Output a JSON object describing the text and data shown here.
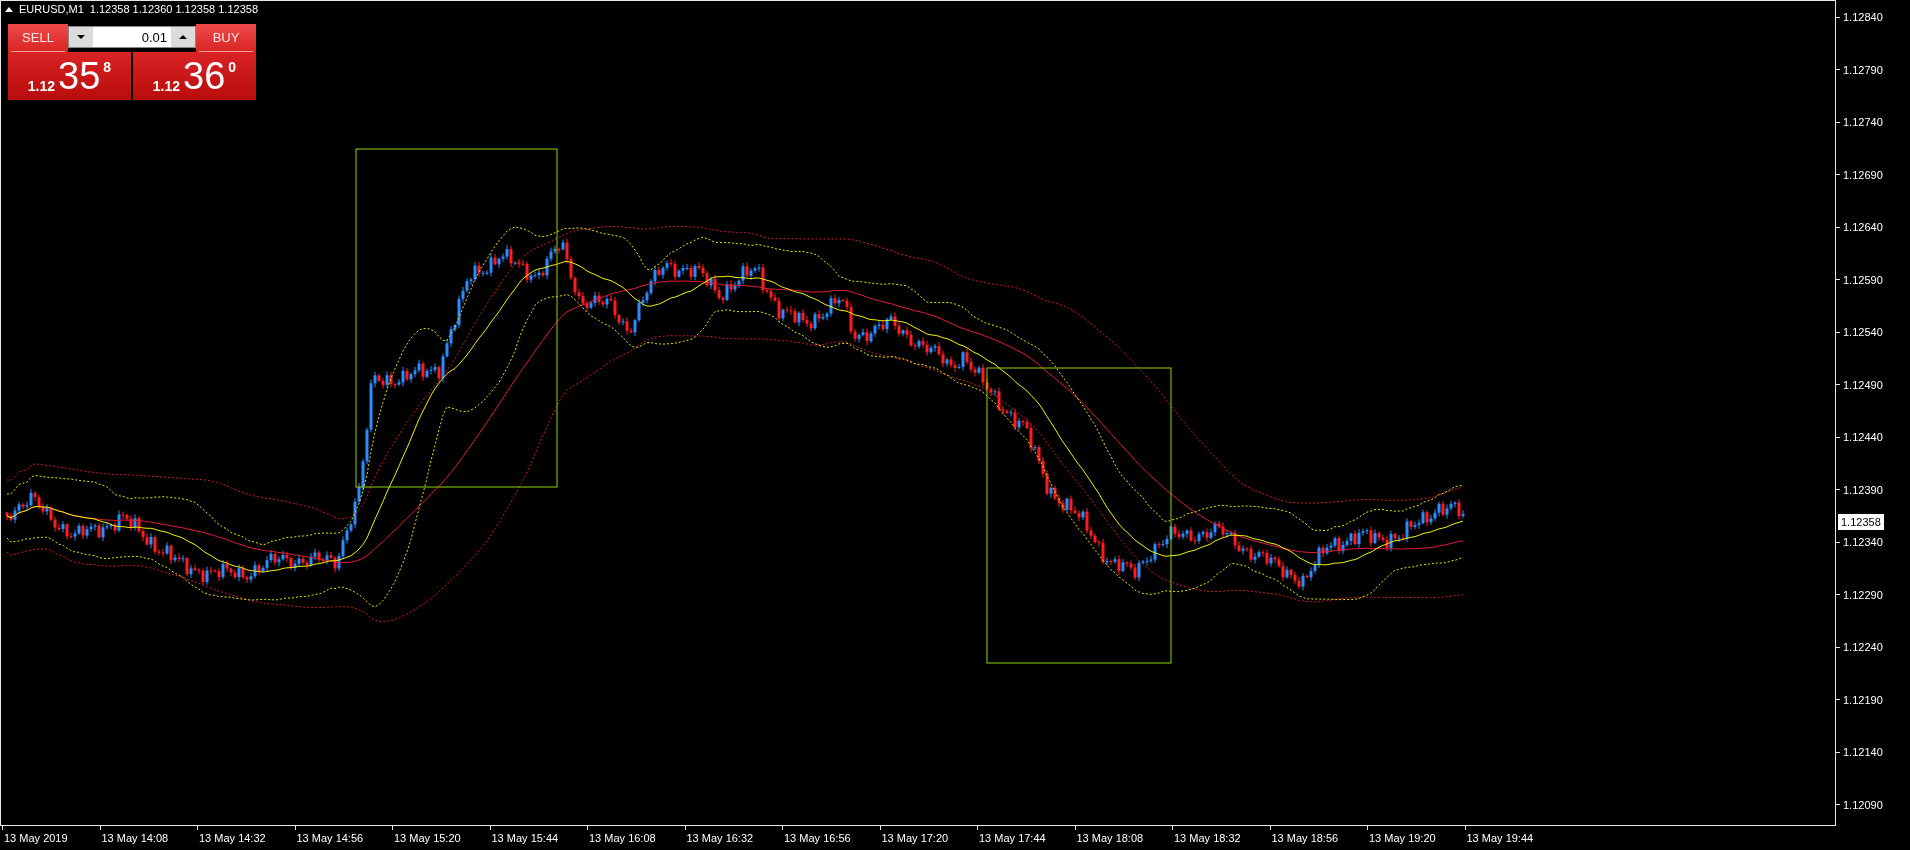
{
  "chart": {
    "symbol": "EURUSD,M1",
    "quote": "1.12358 1.12360 1.12358 1.12358"
  },
  "trade_panel": {
    "sell": {
      "label": "SELL",
      "prefix": "1.12",
      "pips": "35",
      "fraction": "8"
    },
    "lot": {
      "value": "0.01"
    },
    "buy": {
      "label": "BUY",
      "prefix": "1.12",
      "pips": "36",
      "fraction": "0"
    }
  },
  "price_axis": {
    "labels": [
      "1.12840",
      "1.12790",
      "1.12740",
      "1.12690",
      "1.12640",
      "1.12590",
      "1.12540",
      "1.12490",
      "1.12440",
      "1.12390",
      "1.12340",
      "1.12290",
      "1.12240",
      "1.12190",
      "1.12140",
      "1.12090"
    ],
    "current_price": "1.12358"
  },
  "time_axis": {
    "labels": [
      "13 May 2019",
      "13 May 14:08",
      "13 May 14:32",
      "13 May 14:56",
      "13 May 15:20",
      "13 May 15:44",
      "13 May 16:08",
      "13 May 16:32",
      "13 May 16:56",
      "13 May 17:20",
      "13 May 17:44",
      "13 May 18:08",
      "13 May 18:32",
      "13 May 18:56",
      "13 May 19:20",
      "13 May 19:44"
    ]
  }
}
